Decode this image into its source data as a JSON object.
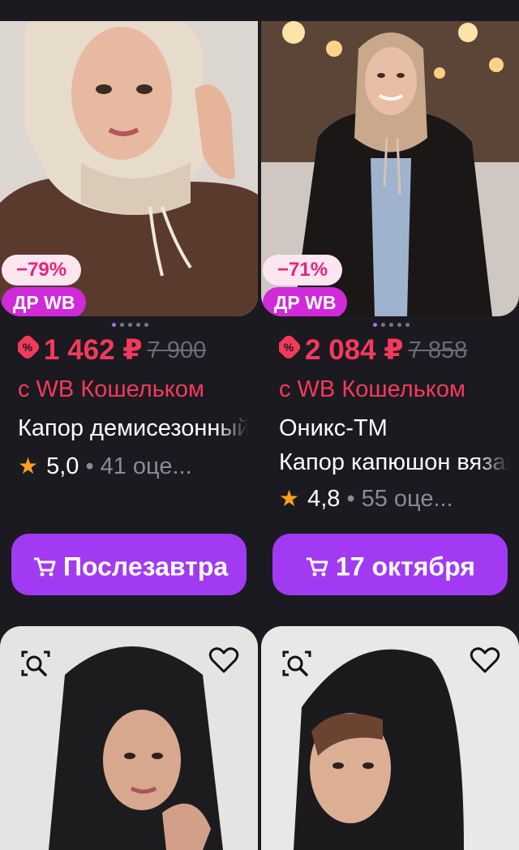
{
  "products": [
    {
      "discount": "−79%",
      "promo": "ДР WB",
      "price": "1 462 ₽",
      "old_price": "7 900",
      "wallet_label": "с WB Кошельком",
      "title_line1": "Капор демисезонный",
      "title_line2": "",
      "rating": "5,0",
      "reviews": "41 оце...",
      "delivery_label": "Послезавтра",
      "active_dot": 0
    },
    {
      "discount": "−71%",
      "promo": "ДР WB",
      "price": "2 084 ₽",
      "old_price": "7 858",
      "wallet_label": "с WB Кошельком",
      "title_line1": "Оникс-ТМ",
      "title_line2": "Капор капюшон вязаный",
      "rating": "4,8",
      "reviews": "55 оце...",
      "delivery_label": "17 октября",
      "active_dot": 0
    }
  ],
  "icons": {
    "similar": "search-similar-icon",
    "favorite": "heart-icon",
    "cart": "cart-icon",
    "star": "star-icon",
    "discount": "discount-percent-icon"
  },
  "colors": {
    "background": "#1b1a20",
    "price": "#f43a5c",
    "button": "#a13af2",
    "promo_badge": "#d02ad9",
    "discount_badge_bg": "#fde6ef",
    "star": "#ff9f1c"
  }
}
